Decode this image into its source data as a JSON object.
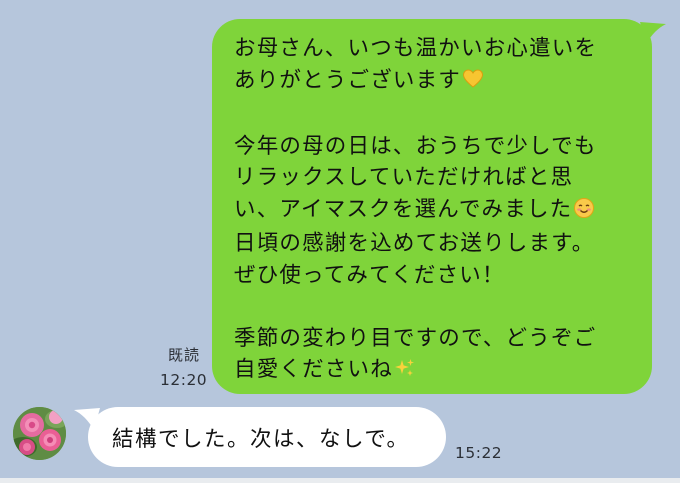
{
  "colors": {
    "background": "#b6c6dc",
    "outgoing_bubble": "#7fd43a",
    "incoming_bubble": "#ffffff",
    "meta_text": "#2b2f36"
  },
  "outgoing_message": {
    "lines": [
      "お母さん、いつも温かいお心遣いを",
      "ありがとうございます",
      "",
      "今年の母の日は、おうちで少しでも",
      "リラックスしていただければと思",
      "い、アイマスクを選んでみました",
      "日頃の感謝を込めてお送りします。",
      "ぜひ使ってみてください！",
      "",
      "季節の変わり目ですので、どうぞご",
      "自愛くださいね"
    ],
    "emojis": {
      "line_2": "yellow-heart",
      "line_6": "smiling-face-with-rosy-cheeks",
      "line_11": "sparkles"
    },
    "read_receipt": "既読",
    "time": "12:20"
  },
  "incoming_message": {
    "text": "結構でした。次は、なしで。",
    "time": "15:22",
    "avatar": "rose-photo-avatar"
  }
}
